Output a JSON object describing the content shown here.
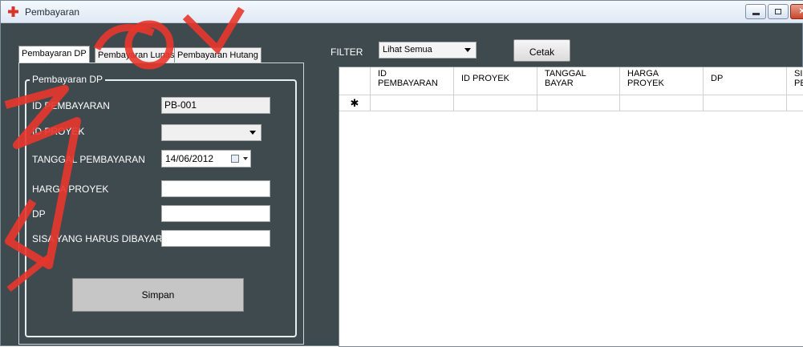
{
  "window": {
    "title": "Pembayaran",
    "icon": "plus-app-icon",
    "controls": {
      "minimize": "minimize-icon",
      "maximize": "maximize-icon",
      "close": "close-icon"
    }
  },
  "tabs": [
    {
      "label": "Pembayaran DP",
      "active": true
    },
    {
      "label": "Pembayaran Lunas",
      "active": false
    },
    {
      "label": "Pembayaran Hutang",
      "active": false
    }
  ],
  "form": {
    "group_title": "Pembayaran DP",
    "id_pembayaran": {
      "label": "ID PEMBAYARAN",
      "value": "PB-001"
    },
    "id_proyek": {
      "label": "ID PROYEK",
      "value": ""
    },
    "tanggal_pembayaran": {
      "label": "TANGGAL PEMBAYARAN",
      "value": "14/06/2012"
    },
    "harga_proyek": {
      "label": "HARGA PROYEK",
      "value": ""
    },
    "dp": {
      "label": "DP",
      "value": ""
    },
    "sisa": {
      "label": "SISA YANG HARUS DIBAYAR",
      "value": ""
    },
    "simpan_label": "Simpan"
  },
  "filter": {
    "label": "FILTER",
    "selected": "Lihat Semua",
    "cetak_label": "Cetak"
  },
  "grid": {
    "columns": [
      "ID\nPEMBAYARAN",
      "ID PROYEK",
      "TANGGAL\nBAYAR",
      "HARGA\nPROYEK",
      "DP",
      "SIS\nPE"
    ],
    "new_row_marker": "✱"
  },
  "colors": {
    "form_background": "#3f4a4f",
    "watermark": "#e8362b"
  }
}
